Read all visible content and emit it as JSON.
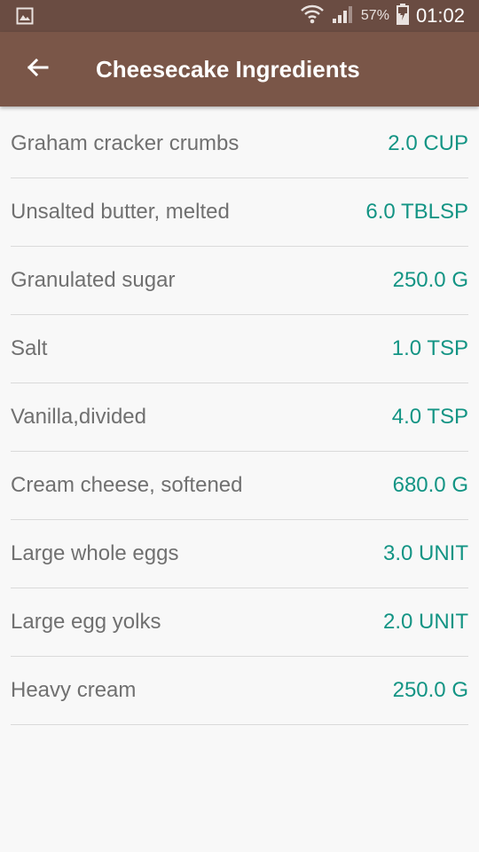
{
  "status_bar": {
    "battery_percent": "57%",
    "time": "01:02"
  },
  "app_bar": {
    "title": "Cheesecake Ingredients",
    "back_icon": "arrow-back-icon"
  },
  "ingredients": [
    {
      "name": "Graham cracker crumbs",
      "quantity": "2.0 CUP"
    },
    {
      "name": "Unsalted butter, melted",
      "quantity": "6.0 TBLSP"
    },
    {
      "name": "Granulated sugar",
      "quantity": "250.0 G"
    },
    {
      "name": "Salt",
      "quantity": "1.0 TSP"
    },
    {
      "name": "Vanilla,divided",
      "quantity": "4.0 TSP"
    },
    {
      "name": "Cream cheese, softened",
      "quantity": "680.0 G"
    },
    {
      "name": "Large whole eggs",
      "quantity": "3.0 UNIT"
    },
    {
      "name": "Large egg yolks",
      "quantity": "2.0 UNIT"
    },
    {
      "name": "Heavy cream",
      "quantity": "250.0 G"
    }
  ],
  "colors": {
    "status_bar": "#6a4c42",
    "app_bar": "#7a5648",
    "quantity_text": "#139484",
    "name_text": "#707070",
    "divider": "#dadada",
    "background": "#f8f8f8"
  }
}
